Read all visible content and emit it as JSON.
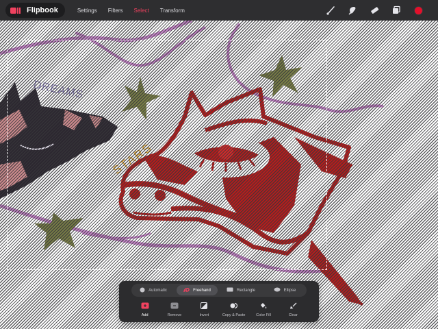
{
  "app": {
    "name": "Flipbook"
  },
  "menu": [
    {
      "label": "Settings",
      "active": false
    },
    {
      "label": "Filters",
      "active": false
    },
    {
      "label": "Select",
      "active": true
    },
    {
      "label": "Transform",
      "active": false
    }
  ],
  "toolbar": {
    "tools": [
      "brush-icon",
      "smudge-icon",
      "eraser-icon",
      "layers-icon"
    ],
    "current_color": "#e3102b"
  },
  "canvas": {
    "texts": {
      "dreams": "DREAMS",
      "stars": "STARS"
    },
    "colors": {
      "ink_red": "#b71c1c",
      "pink": "#cc8a8d",
      "dark_horse": "#2c2730",
      "lilac": "#c483c7",
      "olive_star": "#7b8047",
      "mustard": "#e0a22a",
      "eye_white": "#ffffff"
    }
  },
  "selection_panel": {
    "modes": [
      {
        "label": "Automatic",
        "icon": "circle-icon",
        "active": false
      },
      {
        "label": "Freehand",
        "icon": "lasso-icon",
        "active": true
      },
      {
        "label": "Rectangle",
        "icon": "rectangle-icon",
        "active": false
      },
      {
        "label": "Ellipse",
        "icon": "ellipse-icon",
        "active": false
      }
    ],
    "actions": [
      {
        "label": "Add",
        "icon": "add-icon",
        "active": true
      },
      {
        "label": "Remove",
        "icon": "remove-icon",
        "active": false
      },
      {
        "label": "Invert",
        "icon": "invert-icon",
        "active": false
      },
      {
        "label": "Copy & Paste",
        "icon": "copy-paste-icon",
        "active": false
      },
      {
        "label": "Color Fill",
        "icon": "color-fill-icon",
        "active": false
      },
      {
        "label": "Clear",
        "icon": "clear-icon",
        "active": false
      }
    ]
  }
}
